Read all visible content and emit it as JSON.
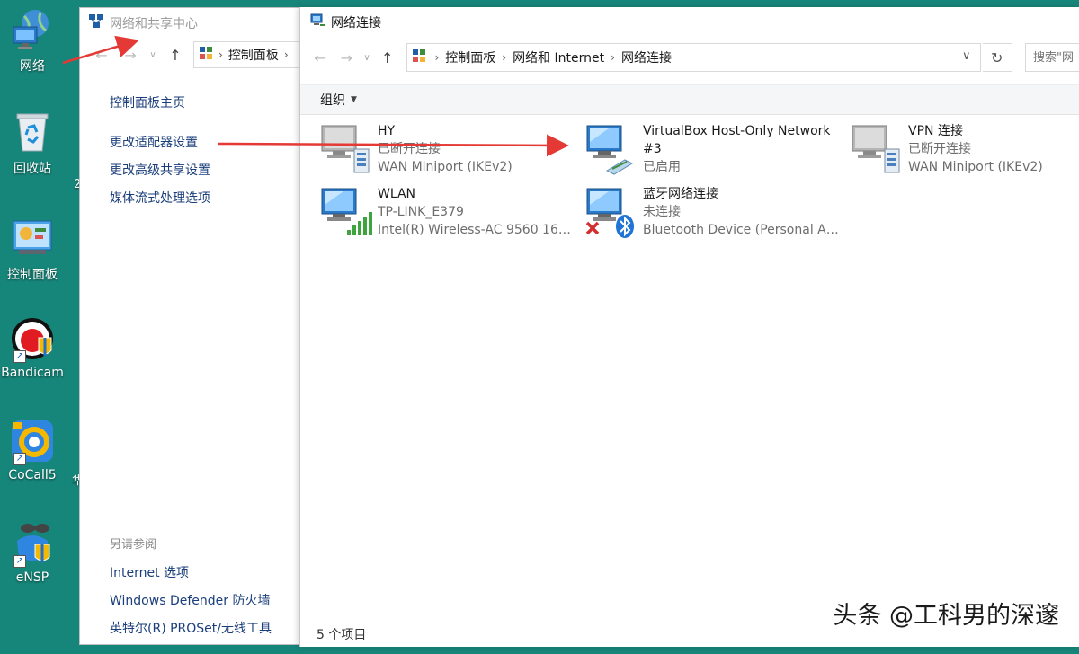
{
  "desktop": {
    "icons": [
      {
        "name": "network",
        "label": "网络"
      },
      {
        "name": "recycle-bin",
        "label": "回收站"
      },
      {
        "name": "control-panel",
        "label": "控制面板"
      },
      {
        "name": "bandicam",
        "label": "Bandicam"
      },
      {
        "name": "cocall5",
        "label": "CoCall5"
      },
      {
        "name": "ensp",
        "label": "eNSP"
      }
    ],
    "edge_chars": [
      "2",
      "华"
    ]
  },
  "sharing_center": {
    "title": "网络和共享中心",
    "address": {
      "segment": "控制面板"
    },
    "links": {
      "home": "控制面板主页",
      "adapter": "更改适配器设置",
      "advanced": "更改高级共享设置",
      "media": "媒体流式处理选项"
    },
    "see_also": {
      "header": "另请参阅",
      "items": [
        "Internet 选项",
        "Windows Defender 防火墙",
        "英特尔(R) PROSet/无线工具"
      ]
    }
  },
  "connections_window": {
    "title": "网络连接",
    "address": {
      "segments": [
        "控制面板",
        "网络和 Internet",
        "网络连接"
      ]
    },
    "search_placeholder": "搜索\"网",
    "toolbar": {
      "organize": "组织"
    },
    "connections": [
      {
        "name": "HY",
        "status": "已断开连接",
        "device": "WAN Miniport (IKEv2)",
        "type": "wan"
      },
      {
        "name": "VirtualBox Host-Only Network #3",
        "status": "已启用",
        "device": "",
        "type": "ethernet"
      },
      {
        "name": "VPN 连接",
        "status": "已断开连接",
        "device": "WAN Miniport (IKEv2)",
        "type": "wan"
      },
      {
        "name": "WLAN",
        "status": "TP-LINK_E379",
        "device": "Intel(R) Wireless-AC 9560 160...",
        "type": "wifi"
      },
      {
        "name": "蓝牙网络连接",
        "status": "未连接",
        "device": "Bluetooth Device (Personal Are...",
        "type": "bluetooth"
      }
    ],
    "status_bar": "5 个项目"
  },
  "watermark": "头条 @工科男的深邃",
  "colors": {
    "desktop_bg": "#17867a",
    "link": "#1a3e7a",
    "annotation_arrow": "#e53935"
  }
}
